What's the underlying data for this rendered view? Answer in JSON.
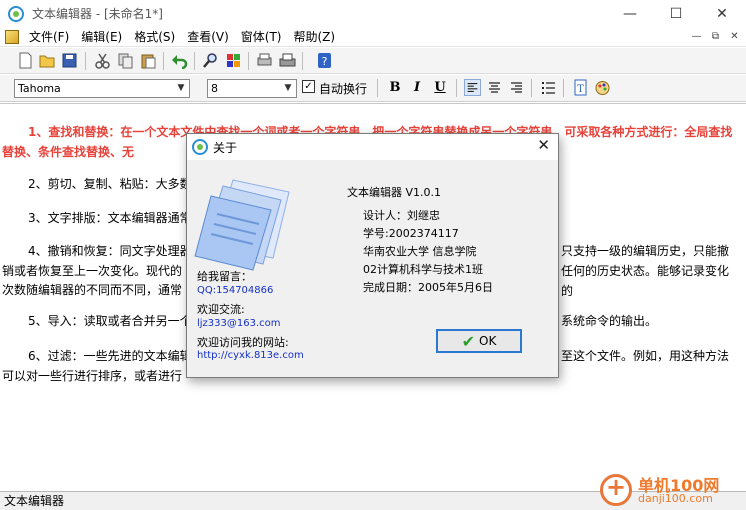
{
  "window": {
    "title": "文本编辑器 - [未命名1*]"
  },
  "menu": [
    "文件(F)",
    "编辑(E)",
    "格式(S)",
    "查看(V)",
    "窗体(T)",
    "帮助(Z)"
  ],
  "toolbar2": {
    "font": "Tahoma",
    "size": "8",
    "wrap_label": "自动换行",
    "wrap_checked": "✓",
    "bold": "B",
    "italic": "I",
    "underline": "U"
  },
  "editor": {
    "p1": "1、查找和替换：在一个文本文件中查找一个词或者一个字符串，把一个字符串替换成另一个字符串。可采取各种方式进行：全局查找替换、条件查找替换、无",
    "p2": "2、剪切、复制、粘贴：大多数",
    "p3": "3、文字排版：文本编辑器通常",
    "p4": "4、撤销和恢复：同文字处理器",
    "p4b": "只支持一级的编辑历史，只能撤",
    "p4c": "销或者恢复至上一次变化。现代的",
    "p4d": "任何的历史状态。能够记录变化的",
    "p4e": "次数随编辑器的不同而不同，通常",
    "p5": "5、导入：读取或者合并另一个",
    "p5b": "系统命令的输出。",
    "p6": "6、过滤：一些先进的文本编辑",
    "p6b": "至这个文件。例如，用这种方法",
    "p6c": "可以对一些行进行排序，或者进行"
  },
  "status": {
    "text": "文本编辑器"
  },
  "watermark": {
    "line1": "单机100网",
    "line2": "danji100.com"
  },
  "about": {
    "title": "关于",
    "app_name": "文本编辑器 V1.0.1",
    "designer": "设计人：刘继忠",
    "student_id": "学号:2002374117",
    "university": "华南农业大学 信息学院",
    "class": "02计算机科学与技术1班",
    "date": "完成日期：2005年5月6日",
    "msg_label": "给我留言：",
    "qq": "QQ:154704866",
    "contact_label": "欢迎交流:",
    "email": "ljz333@163.com",
    "site_label": "欢迎访问我的网站:",
    "site": "http://cyxk.813e.com",
    "ok": "OK"
  }
}
